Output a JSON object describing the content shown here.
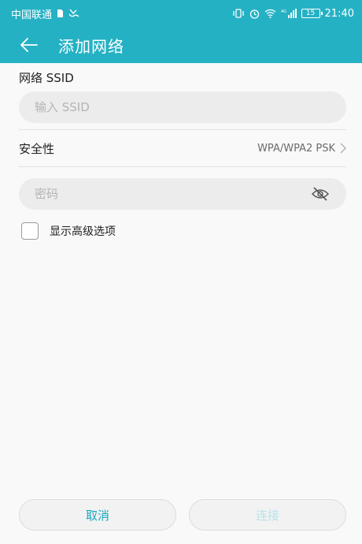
{
  "status_bar": {
    "carrier": "中国联通",
    "battery": "15",
    "time": "21:40",
    "network_type": "4G"
  },
  "app_bar": {
    "title": "添加网络"
  },
  "ssid": {
    "label": "网络 SSID",
    "placeholder": "输入 SSID",
    "value": ""
  },
  "security": {
    "label": "安全性",
    "value": "WPA/WPA2 PSK"
  },
  "password": {
    "placeholder": "密码",
    "value": ""
  },
  "advanced": {
    "label": "显示高级选项",
    "checked": false
  },
  "buttons": {
    "cancel": "取消",
    "connect": "连接"
  },
  "colors": {
    "accent": "#25b1c4",
    "cancel_text": "#1aa6c0",
    "disabled_text": "#b9e2ea"
  }
}
